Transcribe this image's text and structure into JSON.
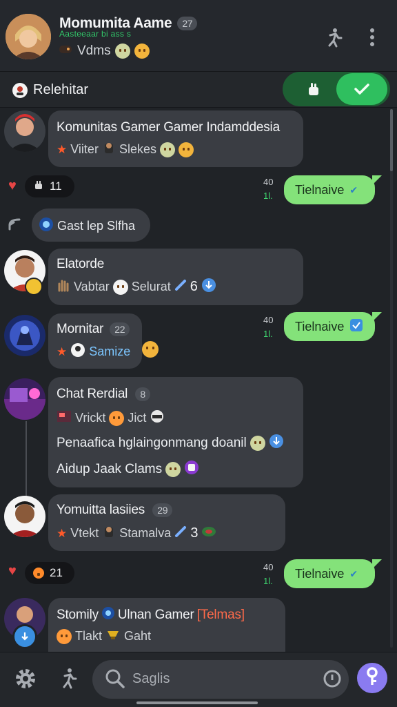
{
  "header": {
    "name": "Momumita Aame",
    "count": "27",
    "subtitle": "Aasteeaar bi ass s",
    "status": "Vdms",
    "icons": [
      "person-run-icon",
      "more-vertical-icon"
    ]
  },
  "topic_bar": {
    "label": "Relehitar",
    "toggle_left_icon": "hand-icon",
    "toggle_right_icon": "check-icon"
  },
  "messages": [
    {
      "title": "Komunitas Gamer Gamer Indamddesia",
      "line": "Viiter",
      "line2": "Slekes"
    },
    {
      "reaction_count": "11",
      "sent_time_top": "40",
      "sent_time_bottom": "1l.",
      "sent_text": "Tielnaive"
    },
    {
      "reply_text": "Gast lep Slfha"
    },
    {
      "title": "Elatorde",
      "line": "Vabtar",
      "line2": "Selurat",
      "num": "6"
    },
    {
      "title": "Mornitar",
      "count": "22",
      "line": "Samize",
      "sent_time_top": "40",
      "sent_time_bottom": "1l.",
      "sent_text": "Tielnaive"
    },
    {
      "title": "Chat Rerdial",
      "count": "8",
      "line": "Vrickt",
      "line2": "Jict",
      "body1": "Penaafica hglaingonmang doanil",
      "body2": "Aidup Jaak Clams"
    },
    {
      "title": "Yomuitta lasiies",
      "count": "29",
      "line": "Vtekt",
      "line2": "Stamalva",
      "num": "3"
    },
    {
      "reaction_count": "21",
      "sent_time_top": "40",
      "sent_time_bottom": "1l.",
      "sent_text": "Tielnaive"
    },
    {
      "title_a": "Stomily",
      "title_b": "Ulnan Gamer",
      "title_c": "[Telmas]",
      "line": "Tlakt",
      "line2": "Gaht"
    }
  ],
  "bottom_bar": {
    "search_placeholder": "Saglis"
  },
  "colors": {
    "accent_green": "#2fbf5f",
    "sent_bubble": "#84e27a",
    "fab": "#8a7bf0",
    "star": "#ff5a2a"
  }
}
